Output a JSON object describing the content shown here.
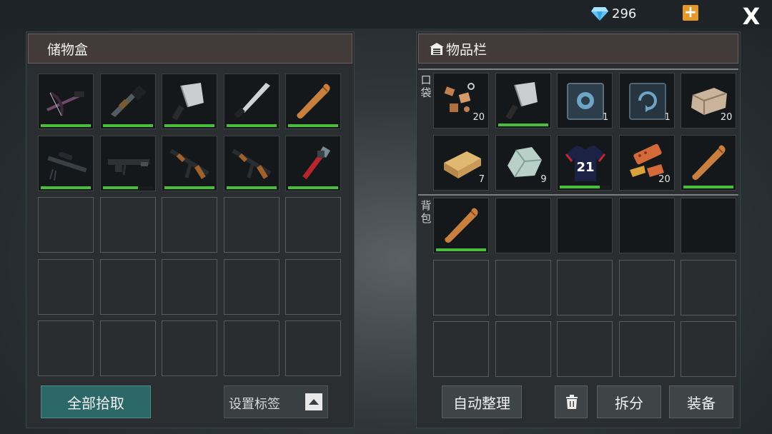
{
  "top_bar": {
    "gem_count": "296",
    "plus_icon": "plus-icon",
    "close_label": "X"
  },
  "storage": {
    "title": "储物盒",
    "slots": [
      {
        "icon": "crossbow-icon",
        "qty": "",
        "durability": 1.0
      },
      {
        "icon": "shotgun-icon",
        "qty": "",
        "durability": 1.0
      },
      {
        "icon": "cleaver-icon",
        "qty": "",
        "durability": 1.0
      },
      {
        "icon": "machete-icon",
        "qty": "",
        "durability": 1.0
      },
      {
        "icon": "baseball-bat-icon",
        "qty": "",
        "durability": 1.0
      },
      {
        "icon": "sniper-rifle-icon",
        "qty": "",
        "durability": 1.0
      },
      {
        "icon": "light-machine-gun-icon",
        "qty": "",
        "durability": 0.7
      },
      {
        "icon": "assault-rifle-icon",
        "qty": "",
        "durability": 1.0
      },
      {
        "icon": "assault-rifle-icon",
        "qty": "",
        "durability": 1.0
      },
      {
        "icon": "pipe-wrench-icon",
        "qty": "",
        "durability": 1.0
      }
    ],
    "total_slots": 25,
    "pickup_all_label": "全部拾取",
    "set_tag_label": "设置标签",
    "dropdown_icon": "triangle-up-icon"
  },
  "inventory": {
    "title": "物品栏",
    "title_icon": "storage-icon",
    "pocket_label": [
      "口",
      "袋"
    ],
    "backpack_label": [
      "背",
      "包"
    ],
    "pocket_slots": [
      {
        "icon": "scrap-parts-icon",
        "qty": "20",
        "durability": null
      },
      {
        "icon": "cleaver-icon",
        "qty": "",
        "durability": 1.0
      },
      {
        "icon": "blueprint-book-icon",
        "qty": "1",
        "durability": null
      },
      {
        "icon": "recipe-book-icon",
        "qty": "1",
        "durability": null
      },
      {
        "icon": "stone-block-icon",
        "qty": "20",
        "durability": null
      },
      {
        "icon": "wood-plank-icon",
        "qty": "7",
        "durability": null
      },
      {
        "icon": "ore-rock-icon",
        "qty": "9",
        "durability": null
      },
      {
        "icon": "jersey-icon",
        "qty": "",
        "durability": 0.8
      },
      {
        "icon": "bricks-icon",
        "qty": "20",
        "durability": null
      },
      {
        "icon": "baseball-bat-icon",
        "qty": "",
        "durability": 1.0
      }
    ],
    "jersey_number": "21",
    "backpack_slots": [
      {
        "icon": "baseball-bat-icon",
        "qty": "",
        "durability": 1.0
      }
    ],
    "backpack_total": 15,
    "backpack_dark_slots": 5,
    "auto_sort_label": "自动整理",
    "trash_icon": "trash-icon",
    "split_label": "拆分",
    "equip_label": "装备"
  },
  "colors": {
    "durability": "#4bbd3c",
    "gem": "#5fc3f5",
    "plus_button": "#e39a2a",
    "pickup_button": "#2c6868",
    "header_bg": "#433b3a"
  }
}
